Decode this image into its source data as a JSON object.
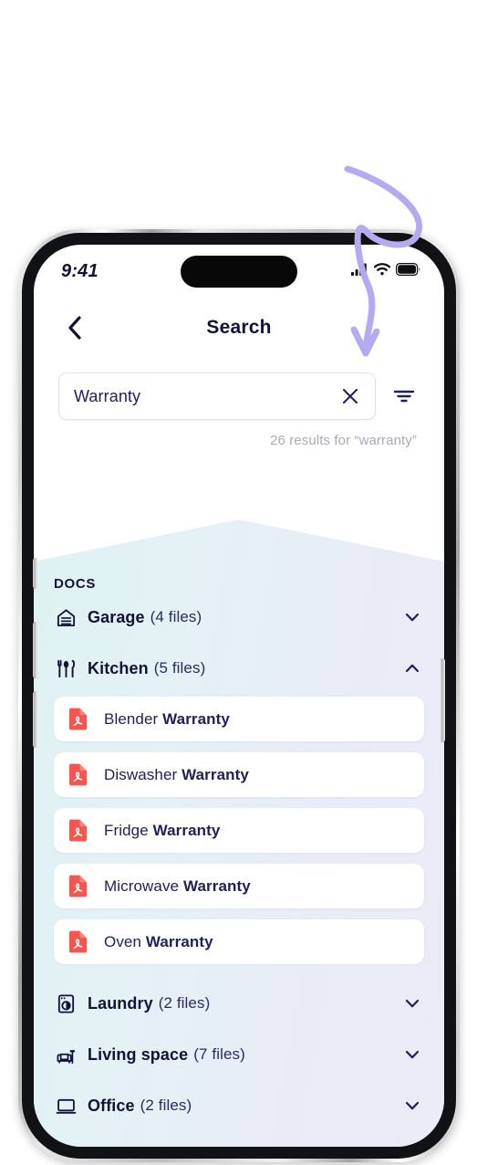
{
  "annotation": {
    "name": "curved-arrow-annotation",
    "color": "#b4aaf0"
  },
  "device": {
    "name": "iphone-mockup"
  },
  "status_bar": {
    "time": "9:41",
    "icons": [
      "cellular-signal-icon",
      "wifi-icon",
      "battery-icon"
    ]
  },
  "nav": {
    "back_icon": "chevron-left-icon",
    "title": "Search"
  },
  "search": {
    "value": "Warranty",
    "placeholder": "Search",
    "clear_icon": "close-icon",
    "filter_icon": "filter-icon",
    "results_text": "26 results for “warranty”"
  },
  "docs": {
    "section_label": "DOCS",
    "folders": [
      {
        "name": "Garage",
        "count": "(4 files)",
        "icon": "garage-icon",
        "expanded": false,
        "chevron": "chevron-down-icon",
        "files": []
      },
      {
        "name": "Kitchen",
        "count": "(5 files)",
        "icon": "kitchen-icon",
        "expanded": true,
        "chevron": "chevron-up-icon",
        "files": [
          {
            "prefix": "Blender ",
            "match": "Warranty",
            "icon": "pdf-icon"
          },
          {
            "prefix": "Diswasher ",
            "match": "Warranty",
            "icon": "pdf-icon"
          },
          {
            "prefix": "Fridge ",
            "match": "Warranty",
            "icon": "pdf-icon"
          },
          {
            "prefix": "Microwave ",
            "match": "Warranty",
            "icon": "pdf-icon"
          },
          {
            "prefix": "Oven ",
            "match": "Warranty",
            "icon": "pdf-icon"
          }
        ]
      },
      {
        "name": "Laundry",
        "count": "(2 files)",
        "icon": "washing-machine-icon",
        "expanded": false,
        "chevron": "chevron-down-icon",
        "files": []
      },
      {
        "name": "Living space",
        "count": "(7 files)",
        "icon": "sofa-lamp-icon",
        "expanded": false,
        "chevron": "chevron-down-icon",
        "files": []
      },
      {
        "name": "Office",
        "count": "(2 files)",
        "icon": "laptop-icon",
        "expanded": false,
        "chevron": "chevron-down-icon",
        "files": []
      }
    ]
  },
  "colors": {
    "ink": "#12123a",
    "body_text": "#20215c",
    "muted": "#a9aabd",
    "pdf_red": "#f4564f",
    "accent_purple": "#b4aaf0",
    "panel_left": "#def2f1",
    "panel_right": "#ecebf8"
  }
}
